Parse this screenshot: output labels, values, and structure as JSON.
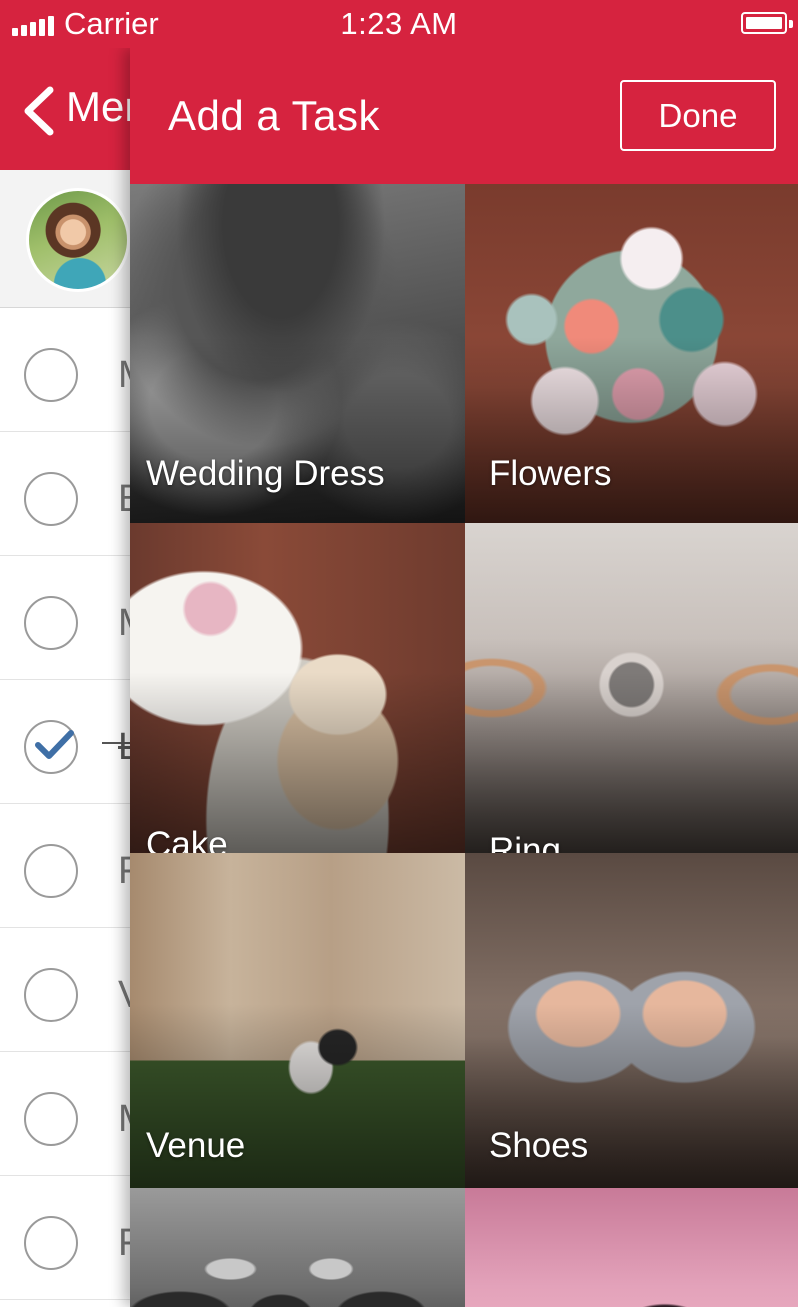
{
  "status_bar": {
    "carrier": "Carrier",
    "time": "1:23 AM",
    "signal_icon": "signal-bars-icon",
    "battery_icon": "battery-full-icon"
  },
  "background_screen": {
    "back_label": "Men",
    "back_icon": "chevron-left-icon",
    "tasks": [
      {
        "label": "M",
        "checked": false
      },
      {
        "label": "B",
        "checked": false
      },
      {
        "label": "M",
        "checked": false
      },
      {
        "label": "L",
        "checked": true
      },
      {
        "label": "F",
        "checked": false
      },
      {
        "label": "V",
        "checked": false
      },
      {
        "label": "M",
        "checked": false
      },
      {
        "label": "F",
        "checked": false
      }
    ]
  },
  "modal": {
    "title": "Add a Task",
    "done_label": "Done",
    "categories": [
      {
        "label": "Wedding Dress"
      },
      {
        "label": "Flowers"
      },
      {
        "label": "Cake"
      },
      {
        "label": "Ring"
      },
      {
        "label": "Venue"
      },
      {
        "label": "Shoes"
      },
      {
        "label": ""
      },
      {
        "label": ""
      }
    ]
  },
  "colors": {
    "brand_red": "#d6233f",
    "check_blue": "#3f6fa6"
  }
}
